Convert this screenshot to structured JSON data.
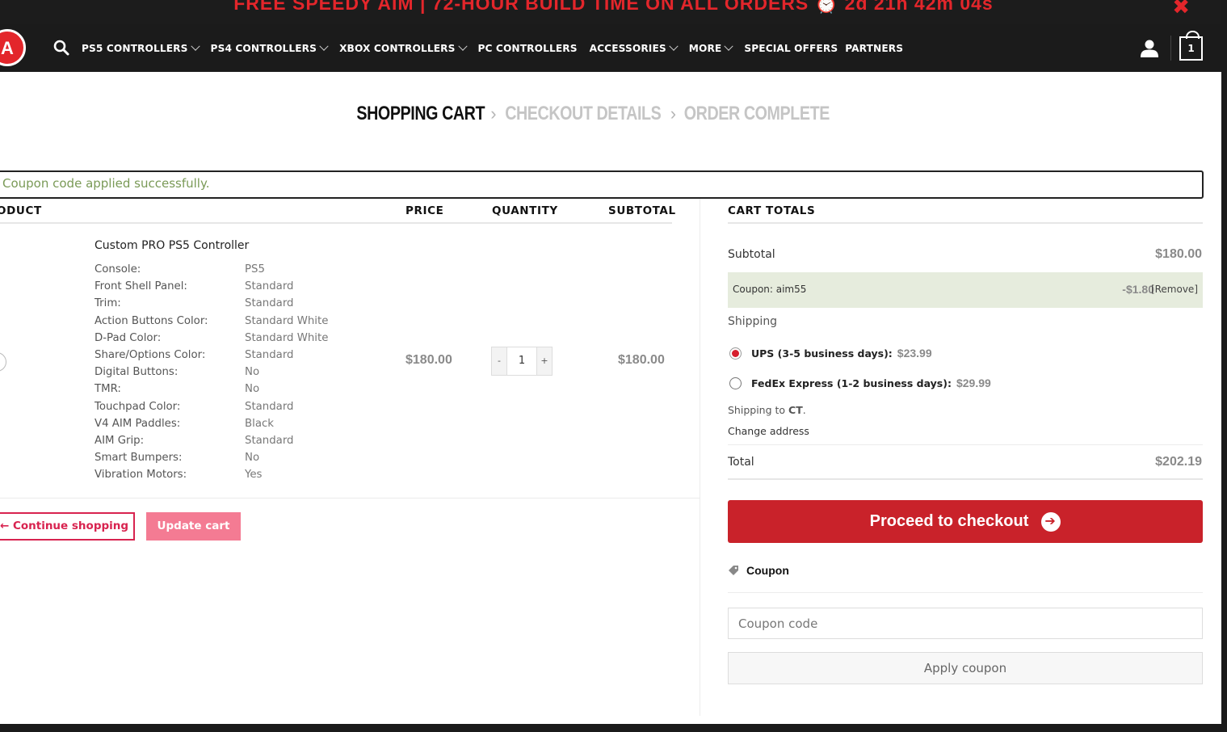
{
  "promo": {
    "text": "FREE SPEEDY AIM | 72-HOUR BUILD TIME ON ALL ORDERS ⏰ 2d 21h 42m 04s",
    "close_glyph": "✖"
  },
  "nav": {
    "logo_letter": "A",
    "items": [
      {
        "label": "PS5 CONTROLLERS",
        "has_dropdown": true
      },
      {
        "label": "PS4 CONTROLLERS",
        "has_dropdown": true
      },
      {
        "label": "XBOX CONTROLLERS",
        "has_dropdown": true
      },
      {
        "label": "PC CONTROLLERS",
        "has_dropdown": false
      },
      {
        "label": "ACCESSORIES",
        "has_dropdown": true
      },
      {
        "label": "MORE",
        "has_dropdown": true
      },
      {
        "label": "SPECIAL OFFERS",
        "has_dropdown": false
      },
      {
        "label": "PARTNERS",
        "has_dropdown": false
      }
    ],
    "cart_count": "1",
    "icons": {
      "search": "search-icon",
      "account": "user-icon",
      "cart": "shopping-bag-icon"
    }
  },
  "steps": {
    "current": "SHOPPING CART",
    "next": "CHECKOUT DETAILS",
    "last": "ORDER COMPLETE",
    "separator": "›"
  },
  "notice": {
    "message": "Coupon code applied successfully."
  },
  "table": {
    "headers": {
      "product": "ODUCT",
      "price": "PRICE",
      "quantity": "QUANTITY",
      "subtotal": "SUBTOTAL"
    },
    "item": {
      "name": "Custom PRO PS5 Controller",
      "variations": [
        {
          "label": "Console:",
          "value": "PS5"
        },
        {
          "label": "Front Shell Panel:",
          "value": "Standard"
        },
        {
          "label": "Trim:",
          "value": "Standard"
        },
        {
          "label": "Action Buttons Color:",
          "value": "Standard White"
        },
        {
          "label": "D-Pad Color:",
          "value": "Standard White"
        },
        {
          "label": "Share/Options Color:",
          "value": "Standard"
        },
        {
          "label": "Digital Buttons:",
          "value": "No"
        },
        {
          "label": "TMR:",
          "value": "No"
        },
        {
          "label": "Touchpad Color:",
          "value": "Standard"
        },
        {
          "label": "V4 AIM Paddles:",
          "value": "Black"
        },
        {
          "label": "AIM Grip:",
          "value": "Standard"
        },
        {
          "label": "Smart Bumpers:",
          "value": "No"
        },
        {
          "label": "Vibration Motors:",
          "value": "Yes"
        }
      ],
      "price": "$180.00",
      "quantity": "1",
      "qty_minus": "-",
      "qty_plus": "+",
      "subtotal": "$180.00"
    }
  },
  "actions": {
    "continue_label": "← Continue shopping",
    "update_label": "Update cart"
  },
  "totals": {
    "title": "CART TOTALS",
    "subtotal_label": "Subtotal",
    "subtotal_value": "$180.00",
    "coupon_label": "Coupon: aim55",
    "coupon_amount": "-$1.80",
    "coupon_remove": "[Remove]",
    "shipping_label": "Shipping",
    "shipping_options": [
      {
        "name": "UPS (3-5 business days):",
        "price": "$23.99",
        "selected": true
      },
      {
        "name": "FedEx Express (1-2 business days):",
        "price": "$29.99",
        "selected": false
      }
    ],
    "shipping_to_prefix": "Shipping to",
    "shipping_to_state": "CT",
    "shipping_to_suffix": ".",
    "change_address": "Change address",
    "total_label": "Total",
    "total_value": "$202.19",
    "checkout_label": "Proceed to checkout",
    "coupon_heading": "Coupon",
    "coupon_placeholder": "Coupon code",
    "apply_label": "Apply coupon"
  },
  "colors": {
    "brand_red": "#c9222a",
    "promo_red": "#e3262b",
    "success_green": "#7a9a57",
    "update_pink": "#f47b93",
    "nav_bg": "#1b1b1b"
  }
}
